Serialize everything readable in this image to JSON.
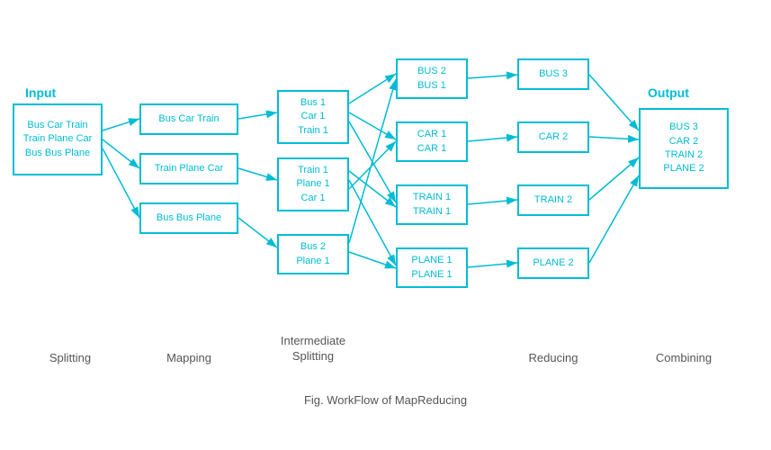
{
  "title": "Fig. WorkFlow of MapReducing",
  "sections": {
    "input_label": "Input",
    "output_label": "Output",
    "splitting_label": "Splitting",
    "mapping_label": "Mapping",
    "intermediate_label": "Intermediate\nSplitting",
    "reducing_label": "Reducing",
    "combining_label": "Combining"
  },
  "boxes": {
    "input": "Bus Car Train\nTrain Plane Car\nBus Bus Plane",
    "map1": "Bus Car Train",
    "map2": "Train Plane Car",
    "map3": "Bus Bus Plane",
    "split1": "Bus 1\nCar 1\nTrain 1",
    "split2": "Train 1\nPlane 1\nCar 1",
    "split3": "Bus 2\nPlane 1",
    "inter1": "BUS 2\nBUS 1",
    "inter2": "CAR 1\nCAR 1",
    "inter3": "TRAIN 1\nTRAIN 1",
    "inter4": "PLANE 1\nPLANE 1",
    "reduce1": "BUS 3",
    "reduce2": "CAR 2",
    "reduce3": "TRAIN 2",
    "reduce4": "PLANE 2",
    "output": "BUS 3\nCAR 2\nTRAIN 2\nPLANE 2"
  }
}
